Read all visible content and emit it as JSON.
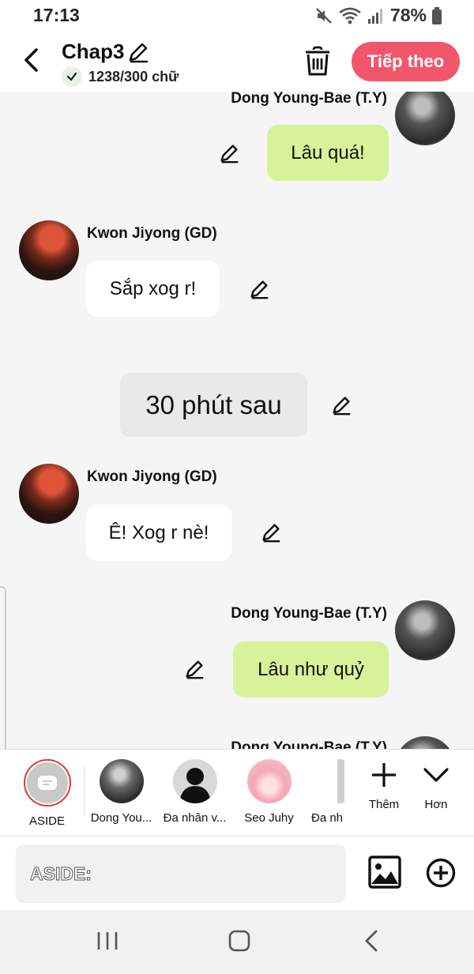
{
  "status_bar": {
    "time": "17:13",
    "battery": "78%"
  },
  "header": {
    "title": "Chap3",
    "word_count": "1238/300 chữ",
    "next_label": "Tiếp theo",
    "accent_color": "#f2566b"
  },
  "messages": [
    {
      "type": "right",
      "sender": "Dong Young-Bae (T.Y)",
      "text": "Lâu quá!"
    },
    {
      "type": "left",
      "sender": "Kwon Jiyong (GD)",
      "text": "Sắp xog r!"
    },
    {
      "type": "narration",
      "text": "30 phút sau"
    },
    {
      "type": "left",
      "sender": "Kwon Jiyong (GD)",
      "text": "Ê! Xog r nè!"
    },
    {
      "type": "right",
      "sender": "Dong Young-Bae (T.Y)",
      "text": "Lâu như quỷ"
    },
    {
      "type": "right",
      "sender": "Dong Young-Bae (T.Y)",
      "text": ""
    }
  ],
  "characters": [
    {
      "name": "ASIDE",
      "selected": true
    },
    {
      "name": "Dong You..."
    },
    {
      "name": "Đa nhân v..."
    },
    {
      "name": "Seo Juhy"
    },
    {
      "name": "Đa nh"
    }
  ],
  "tools": {
    "add_label": "Thêm",
    "more_label": "Hơn"
  },
  "input": {
    "placeholder": "ASIDE:"
  }
}
